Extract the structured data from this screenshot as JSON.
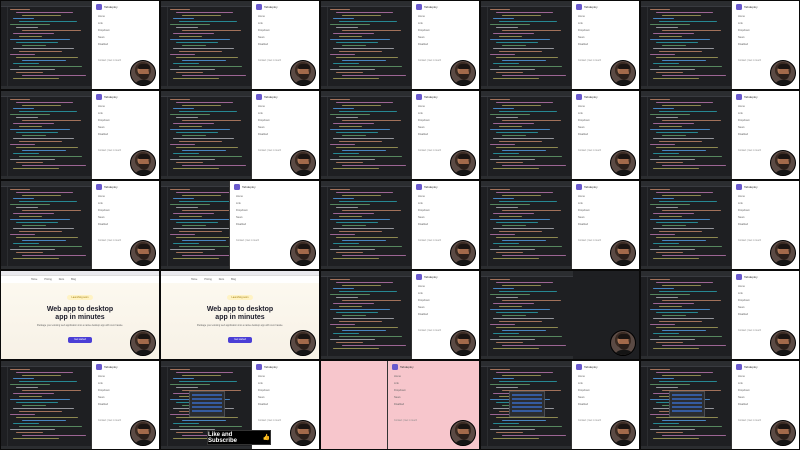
{
  "app": {
    "title": "Tabdeploy",
    "nav_items": [
      "Home",
      "Link",
      "Dropdown",
      "News",
      "Disabled"
    ],
    "footer": "Contact | Get in touch"
  },
  "landing": {
    "nav_items": [
      "Home",
      "Pricing",
      "Docs",
      "Blog"
    ],
    "badge": "Launching soon",
    "headline_line1": "Web app to desktop",
    "headline_line2": "app in minutes",
    "subtitle": "Package your existing web application into a native desktop app with zero hassle.",
    "cta": "Get started"
  },
  "overlay": {
    "subscribe_label": "Like and Subscribe",
    "thumb_icon": "👍"
  },
  "colors": {
    "editor_bg": "#1e1f22",
    "app_bg": "#ffffff",
    "accent": "#6a5acd",
    "pink_tile": "#f7c6cc"
  }
}
